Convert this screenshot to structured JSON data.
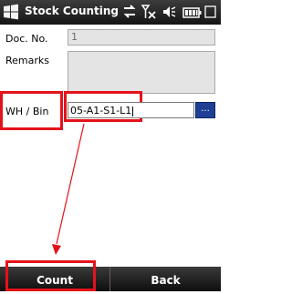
{
  "titlebar": {
    "title": "Stock Counting",
    "icons": [
      "windows-start-icon",
      "connectivity-icon",
      "signal-off-icon",
      "volume-icon",
      "battery-icon"
    ]
  },
  "form": {
    "doc_no_label": "Doc. No.",
    "doc_no_value": "1",
    "remarks_label": "Remarks",
    "remarks_value": "",
    "whbin_label": "WH / Bin",
    "whbin_value": "05-A1-S1-L1",
    "browse_label": "..."
  },
  "softkeys": {
    "left_label": "Count",
    "right_label": "Back"
  },
  "colors": {
    "highlight": "#e4121b",
    "titlebar": "#1f1f1f",
    "browse": "#1e3f93"
  }
}
